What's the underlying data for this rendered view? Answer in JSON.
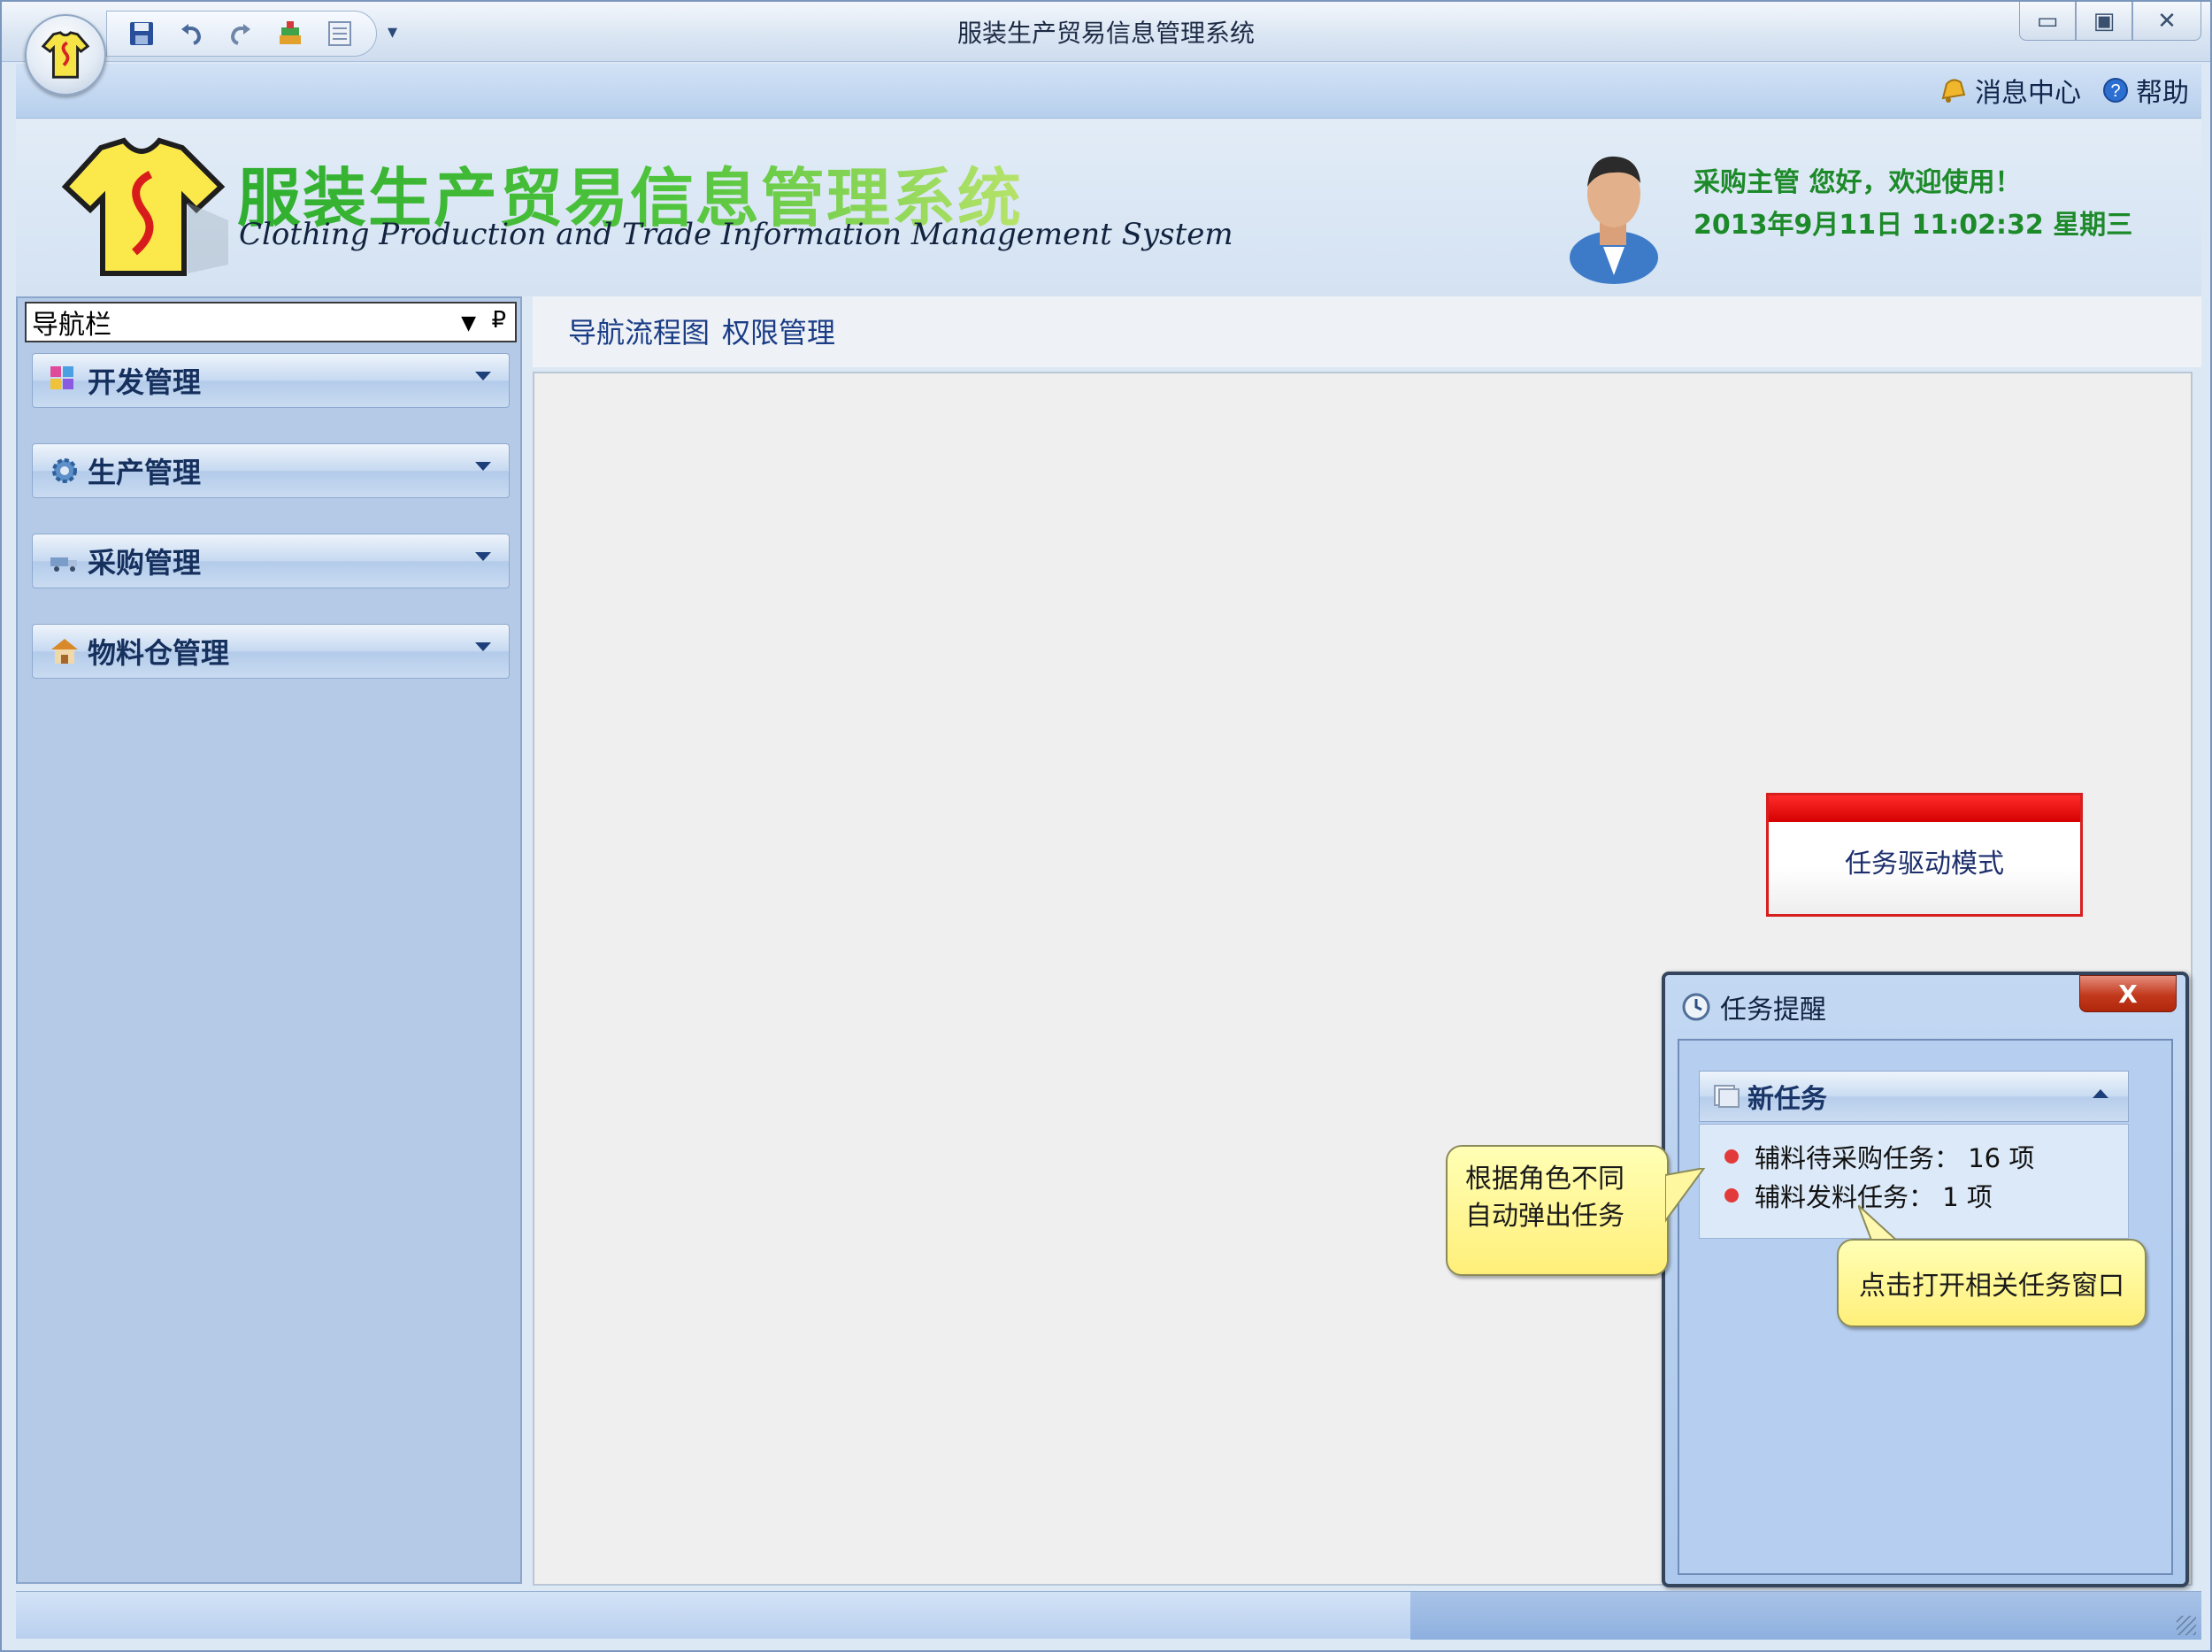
{
  "window": {
    "title": "服装生产贸易信息管理系统",
    "controls": [
      "minimize-icon",
      "maximize-icon",
      "close-icon"
    ]
  },
  "quick_access": [
    "save-icon",
    "undo-icon",
    "redo-icon",
    "layers-icon",
    "form-icon"
  ],
  "menu": {
    "message_center": "消息中心",
    "help": "帮助"
  },
  "banner": {
    "title_cn": "服装生产贸易信息管理系统",
    "title_en": "Clothing Production and Trade Information Management System",
    "greeting_line1": "采购主管  您好，欢迎使用！",
    "greeting_line2": "2013年9月11日 11:02:32 星期三"
  },
  "sidebar": {
    "header": "导航栏",
    "items": [
      {
        "label": "开发管理",
        "icon": "palette-icon"
      },
      {
        "label": "生产管理",
        "icon": "gear-icon"
      },
      {
        "label": "采购管理",
        "icon": "truck-icon"
      },
      {
        "label": "物料仓管理",
        "icon": "warehouse-icon"
      }
    ]
  },
  "tabs": [
    "导航流程图",
    "权限管理"
  ],
  "task_mode_button": "任务驱动模式",
  "popup": {
    "title": "任务提醒",
    "close": "X",
    "section_title": "新任务",
    "tasks": [
      "辅料待采购任务： 16 项",
      "辅料发料任务： 1 项"
    ]
  },
  "callouts": {
    "role_popup": [
      "根据角色不同",
      "自动弹出任务"
    ],
    "click_open": "点击打开相关任务窗口"
  },
  "colors": {
    "accent_green": "#1d8a2a",
    "nav_blue": "#16305e",
    "alert_red": "#d81f1f",
    "callout_yellow": "#ffef7a"
  }
}
